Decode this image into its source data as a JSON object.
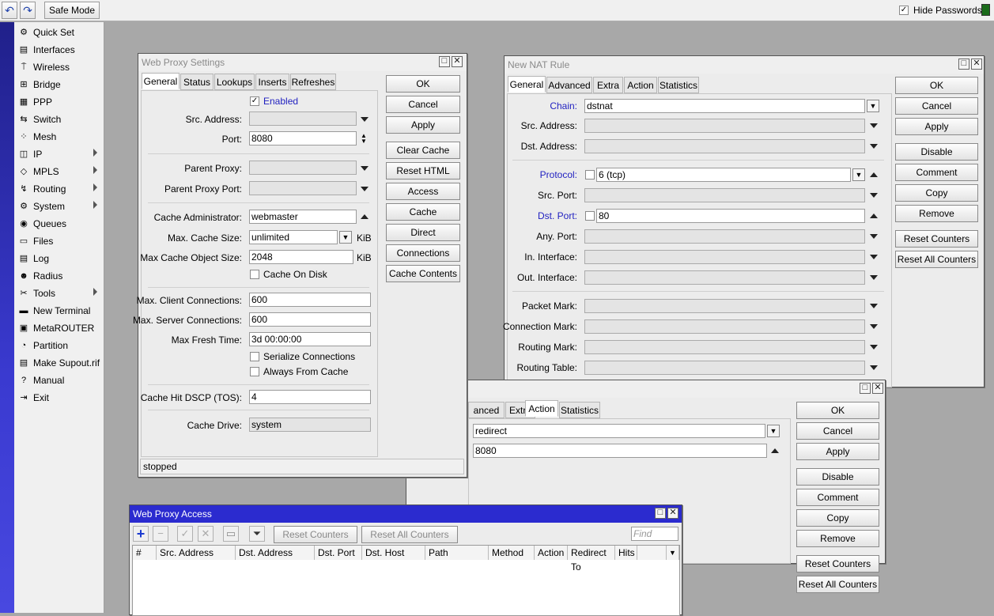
{
  "topbar": {
    "undo_icon": "undo-icon",
    "redo_icon": "redo-icon",
    "safe_mode": "Safe Mode",
    "hide_passwords": "Hide Passwords"
  },
  "menu": [
    {
      "label": "Quick Set",
      "icon": "quick-set-icon",
      "sub": false
    },
    {
      "label": "Interfaces",
      "icon": "interfaces-icon",
      "sub": false
    },
    {
      "label": "Wireless",
      "icon": "wireless-icon",
      "sub": false
    },
    {
      "label": "Bridge",
      "icon": "bridge-icon",
      "sub": false
    },
    {
      "label": "PPP",
      "icon": "ppp-icon",
      "sub": false
    },
    {
      "label": "Switch",
      "icon": "switch-icon",
      "sub": false
    },
    {
      "label": "Mesh",
      "icon": "mesh-icon",
      "sub": false
    },
    {
      "label": "IP",
      "icon": "ip-icon",
      "sub": true
    },
    {
      "label": "MPLS",
      "icon": "mpls-icon",
      "sub": true
    },
    {
      "label": "Routing",
      "icon": "routing-icon",
      "sub": true
    },
    {
      "label": "System",
      "icon": "system-icon",
      "sub": true
    },
    {
      "label": "Queues",
      "icon": "queues-icon",
      "sub": false
    },
    {
      "label": "Files",
      "icon": "files-icon",
      "sub": false
    },
    {
      "label": "Log",
      "icon": "log-icon",
      "sub": false
    },
    {
      "label": "Radius",
      "icon": "radius-icon",
      "sub": false
    },
    {
      "label": "Tools",
      "icon": "tools-icon",
      "sub": true
    },
    {
      "label": "New Terminal",
      "icon": "terminal-icon",
      "sub": false
    },
    {
      "label": "MetaROUTER",
      "icon": "metarouter-icon",
      "sub": false
    },
    {
      "label": "Partition",
      "icon": "partition-icon",
      "sub": false
    },
    {
      "label": "Make Supout.rif",
      "icon": "supout-icon",
      "sub": false
    },
    {
      "label": "Manual",
      "icon": "manual-icon",
      "sub": false
    },
    {
      "label": "Exit",
      "icon": "exit-icon",
      "sub": false
    }
  ],
  "proxy": {
    "title": "Web Proxy Settings",
    "tabs": [
      "General",
      "Status",
      "Lookups",
      "Inserts",
      "Refreshes"
    ],
    "enabled": "Enabled",
    "src_address": "Src. Address:",
    "port_label": "Port:",
    "port": "8080",
    "parent_proxy": "Parent Proxy:",
    "parent_proxy_port": "Parent Proxy Port:",
    "cache_admin_label": "Cache Administrator:",
    "cache_admin": "webmaster",
    "max_cache_size_label": "Max. Cache Size:",
    "max_cache_size": "unlimited",
    "kib": "KiB",
    "max_obj_label": "Max Cache Object Size:",
    "max_obj": "2048",
    "cache_on_disk": "Cache On Disk",
    "max_client_label": "Max. Client Connections:",
    "max_client": "600",
    "max_server_label": "Max. Server Connections:",
    "max_server": "600",
    "max_fresh_label": "Max Fresh Time:",
    "max_fresh": "3d 00:00:00",
    "serialize": "Serialize Connections",
    "always_cache": "Always From Cache",
    "dscp_label": "Cache Hit DSCP (TOS):",
    "dscp": "4",
    "drive_label": "Cache Drive:",
    "drive": "system",
    "status": "stopped",
    "buttons": [
      "OK",
      "Cancel",
      "Apply",
      "Clear Cache",
      "Reset HTML",
      "Access",
      "Cache",
      "Direct",
      "Connections",
      "Cache Contents"
    ]
  },
  "nat": {
    "title": "New NAT Rule",
    "tabs": [
      "General",
      "Advanced",
      "Extra",
      "Action",
      "Statistics"
    ],
    "chain_label": "Chain:",
    "chain": "dstnat",
    "src_address": "Src. Address:",
    "dst_address": "Dst. Address:",
    "protocol_label": "Protocol:",
    "protocol": "6 (tcp)",
    "src_port": "Src. Port:",
    "dst_port_label": "Dst. Port:",
    "dst_port": "80",
    "any_port": "Any. Port:",
    "in_iface": "In. Interface:",
    "out_iface": "Out. Interface:",
    "packet_mark": "Packet Mark:",
    "conn_mark": "Connection Mark:",
    "routing_mark": "Routing Mark:",
    "routing_table": "Routing Table:",
    "buttons": [
      "OK",
      "Cancel",
      "Apply",
      "Disable",
      "Comment",
      "Copy",
      "Remove",
      "Reset Counters",
      "Reset All Counters"
    ]
  },
  "nat2": {
    "tabs": [
      "anced",
      "Extra",
      "Action",
      "Statistics"
    ],
    "action": "redirect",
    "to_ports": "8080",
    "buttons": [
      "OK",
      "Cancel",
      "Apply",
      "Disable",
      "Comment",
      "Copy",
      "Remove",
      "Reset Counters",
      "Reset All Counters"
    ]
  },
  "access": {
    "title": "Web Proxy Access",
    "reset_counters": "Reset Counters",
    "reset_all": "Reset All Counters",
    "find_placeholder": "Find",
    "columns": [
      "#",
      "Src. Address",
      "Dst. Address",
      "Dst. Port",
      "Dst. Host",
      "Path",
      "Method",
      "Action",
      "Redirect To",
      "Hits"
    ]
  }
}
